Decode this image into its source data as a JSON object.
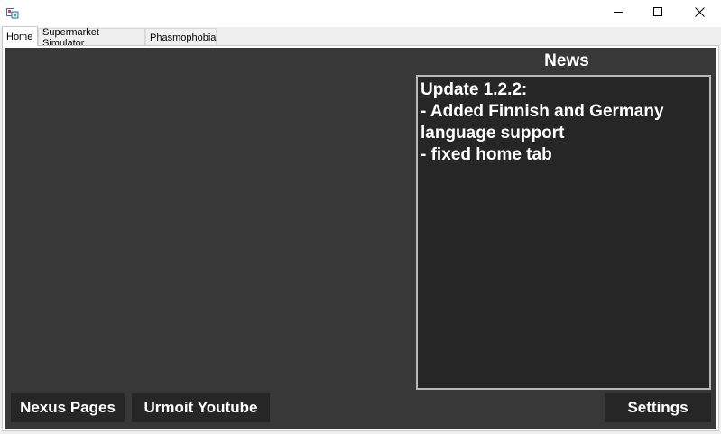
{
  "window": {
    "title": "",
    "icon": "app-icon",
    "controls": [
      "minimize-icon",
      "maximize-icon",
      "close-icon"
    ]
  },
  "tabs": [
    {
      "label": "Home",
      "active": true
    },
    {
      "label": "Supermarket Simulator",
      "active": false
    },
    {
      "label": "Phasmophobia",
      "active": false
    }
  ],
  "news": {
    "title": "News",
    "content": "Update 1.2.2:\n- Added Finnish and Germany language support\n- fixed home tab"
  },
  "buttons": {
    "nexus": "Nexus Pages",
    "youtube": "Urmoit Youtube",
    "settings": "Settings"
  },
  "colors": {
    "panel_bg": "#383838",
    "button_bg": "#262626",
    "text": "#ffffff"
  }
}
